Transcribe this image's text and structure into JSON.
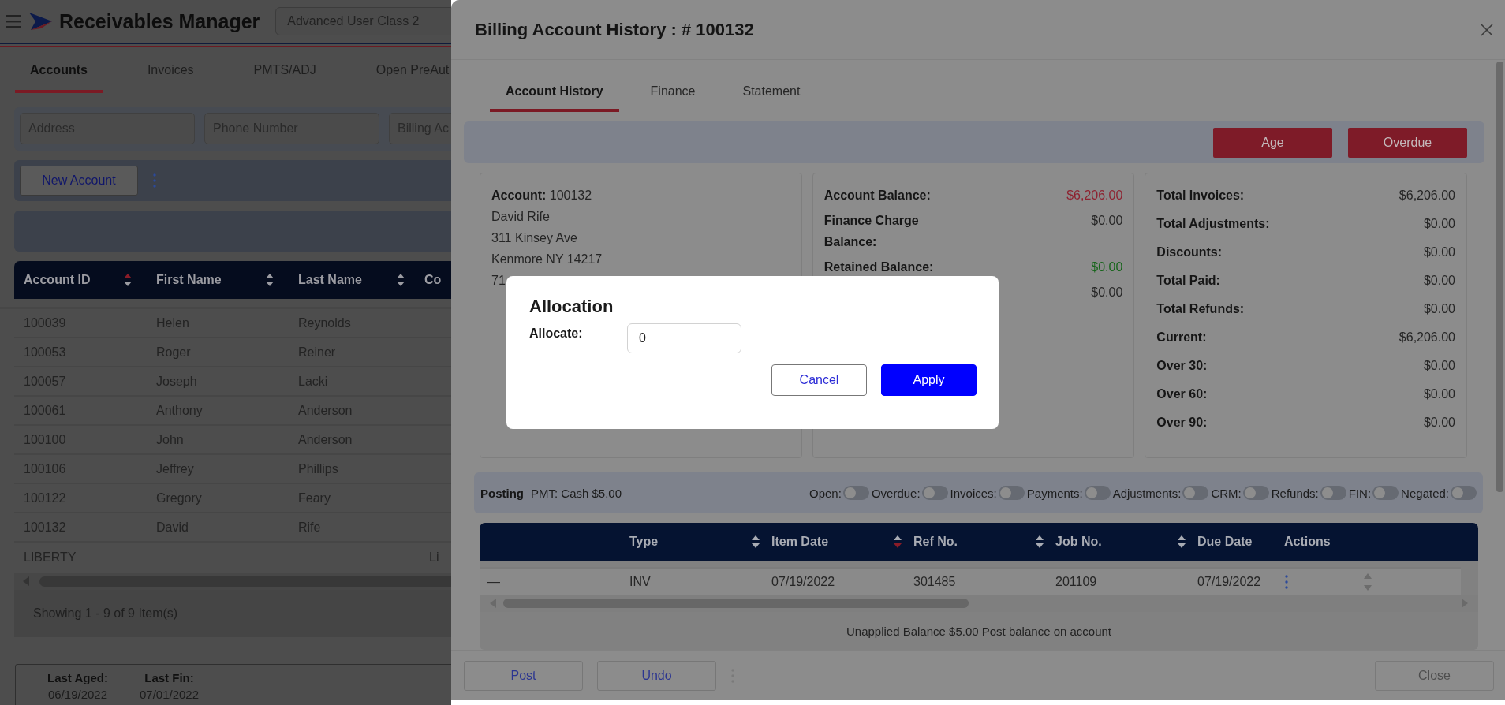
{
  "app": {
    "title": "Receivables Manager",
    "user_class": "Advanced User Class 2"
  },
  "main_tabs": [
    {
      "label": "Accounts",
      "selected": true
    },
    {
      "label": "Invoices",
      "selected": false
    },
    {
      "label": "PMTS/ADJ",
      "selected": false
    },
    {
      "label": "Open PreAut",
      "selected": false
    }
  ],
  "filters": [
    {
      "placeholder": "Address"
    },
    {
      "placeholder": "Phone Number"
    },
    {
      "placeholder": "Billing Ac"
    }
  ],
  "toolbar": {
    "button": "New Account"
  },
  "accounts_table": {
    "columns": [
      {
        "label": "Account ID",
        "sortable": true,
        "sorted_up": true,
        "sorted_down": false
      },
      {
        "label": "First Name",
        "sortable": true,
        "sorted_up": false,
        "sorted_down": false
      },
      {
        "label": "Last Name",
        "sortable": true,
        "sorted_up": false,
        "sorted_down": false
      },
      {
        "label": "Co"
      }
    ],
    "rows": [
      [
        "100039",
        "Helen",
        "Reynolds"
      ],
      [
        "100053",
        "Roger",
        "Reiner"
      ],
      [
        "100057",
        "Joseph",
        "Lacki"
      ],
      [
        "100061",
        "Anthony",
        "Anderson"
      ],
      [
        "100100",
        "John",
        "Anderson"
      ],
      [
        "100106",
        "Jeffrey",
        "Phillips"
      ],
      [
        "100122",
        "Gregory",
        "Feary"
      ],
      [
        "100132",
        "David",
        "Rife"
      ]
    ],
    "group_row": [
      "LIBERTY",
      "Li"
    ]
  },
  "pager": "Showing 1 - 9 of 9 Item(s)",
  "last_dates": [
    {
      "label": "Last Aged:",
      "value": "06/19/2022"
    },
    {
      "label": "Last Fin:",
      "value": "07/01/2022"
    }
  ],
  "drawer": {
    "title": "Billing Account History : # 100132",
    "tabs": [
      {
        "label": "Account History",
        "selected": true
      },
      {
        "label": "Finance",
        "selected": false
      },
      {
        "label": "Statement",
        "selected": false
      }
    ],
    "actions": [
      "Age",
      "Overdue"
    ],
    "account": {
      "label": "Account:",
      "number": "100132",
      "lines": [
        "David Rife",
        "311 Kinsey Ave",
        "Kenmore NY 14217",
        "71"
      ]
    },
    "balances": [
      {
        "label": "Account Balance:",
        "value": "$6,206.00",
        "color": "#8e2230"
      },
      {
        "label": "Finance Charge Balance:",
        "value": "$0.00",
        "color": "#262626"
      },
      {
        "label": "Retained Balance:",
        "value": "$0.00",
        "color": "#16651a"
      },
      {
        "value": "$0.00",
        "color": "#262626"
      }
    ],
    "totals": [
      {
        "label": "Total Invoices:",
        "value": "$6,206.00"
      },
      {
        "label": "Total Adjustments:",
        "value": "$0.00"
      },
      {
        "label": "Discounts:",
        "value": "$0.00"
      },
      {
        "label": "Total Paid:",
        "value": "$0.00"
      },
      {
        "label": "Total Refunds:",
        "value": "$0.00"
      },
      {
        "label": "Current:",
        "value": "$6,206.00"
      },
      {
        "label": "Over 30:",
        "value": "$0.00"
      },
      {
        "label": "Over 60:",
        "value": "$0.00"
      },
      {
        "label": "Over 90:",
        "value": "$0.00"
      }
    ],
    "posting": {
      "label": "Posting",
      "detail": "PMT: Cash $5.00",
      "filters": [
        {
          "label": "Open:",
          "on": false
        },
        {
          "label": "Overdue:",
          "on": false
        },
        {
          "label": "Invoices:",
          "on": false
        },
        {
          "label": "Payments:",
          "on": false
        },
        {
          "label": "Adjustments:",
          "on": false
        },
        {
          "label": "CRM:",
          "on": false
        },
        {
          "label": "Refunds:",
          "on": false
        },
        {
          "label": "FIN:",
          "on": false
        },
        {
          "label": "Negated:",
          "on": false
        }
      ]
    },
    "history_table": {
      "columns": [
        {
          "label": "Type",
          "sortable": true,
          "sorted_up": false,
          "sorted_down": false
        },
        {
          "label": "Item Date",
          "sortable": true,
          "sorted_up": false,
          "sorted_down": true
        },
        {
          "label": "Ref No.",
          "sortable": true,
          "sorted_up": false,
          "sorted_down": false
        },
        {
          "label": "Job No.",
          "sortable": true,
          "sorted_up": false,
          "sorted_down": false
        },
        {
          "label": "Due Date"
        },
        {
          "label": "Actions"
        }
      ],
      "rows": [
        {
          "marker": "—",
          "cells": [
            "INV",
            "07/19/2022",
            "301485",
            "201109",
            "07/19/2022"
          ]
        }
      ]
    },
    "summary": "Unapplied Balance $5.00 Post balance on account",
    "buttons": [
      {
        "label": "Post",
        "disabled": false
      },
      {
        "label": "Undo",
        "disabled": false
      },
      {
        "label": "Close",
        "disabled": true
      }
    ]
  },
  "dialog": {
    "title": "Allocation",
    "field_label": "Allocate:",
    "value": "0",
    "buttons": [
      {
        "label": "Cancel",
        "kind": "secondary"
      },
      {
        "label": "Apply",
        "kind": "primary"
      }
    ]
  }
}
